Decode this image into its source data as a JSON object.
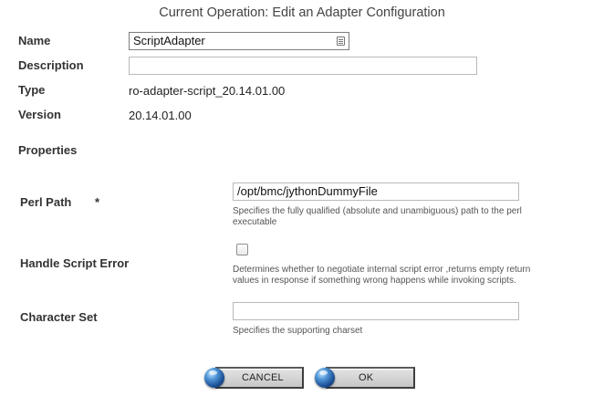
{
  "header": {
    "title": "Current Operation: Edit an Adapter Configuration"
  },
  "fields": {
    "name": {
      "label": "Name",
      "value": "ScriptAdapter"
    },
    "description": {
      "label": "Description",
      "value": ""
    },
    "type": {
      "label": "Type",
      "value": "ro-adapter-script_20.14.01.00"
    },
    "version": {
      "label": "Version",
      "value": "20.14.01.00"
    }
  },
  "properties": {
    "heading": "Properties",
    "perl_path": {
      "label": "Perl Path",
      "required_marker": "*",
      "value": "/opt/bmc/jythonDummyFile",
      "help_line1": "Specifies the fully qualified (absolute and unambiguous) path to the perl",
      "help_line2": "executable"
    },
    "handle_script_error": {
      "label": "Handle Script Error",
      "checked": false,
      "help_line1": "Determines whether to negotiate internal script error ,returns empty return",
      "help_line2": "values in response if something wrong happens while invoking scripts."
    },
    "character_set": {
      "label": "Character Set",
      "value": "",
      "help": "Specifies the supporting charset"
    }
  },
  "buttons": {
    "cancel_label": "CANCEL",
    "ok_label": "OK"
  },
  "icons": {
    "name_field_icon": "calendar-icon",
    "button_orb": "blue-orb-icon"
  },
  "colors": {
    "orb_blue": "#1c4f96",
    "button_gray": "#c6c6c6"
  }
}
